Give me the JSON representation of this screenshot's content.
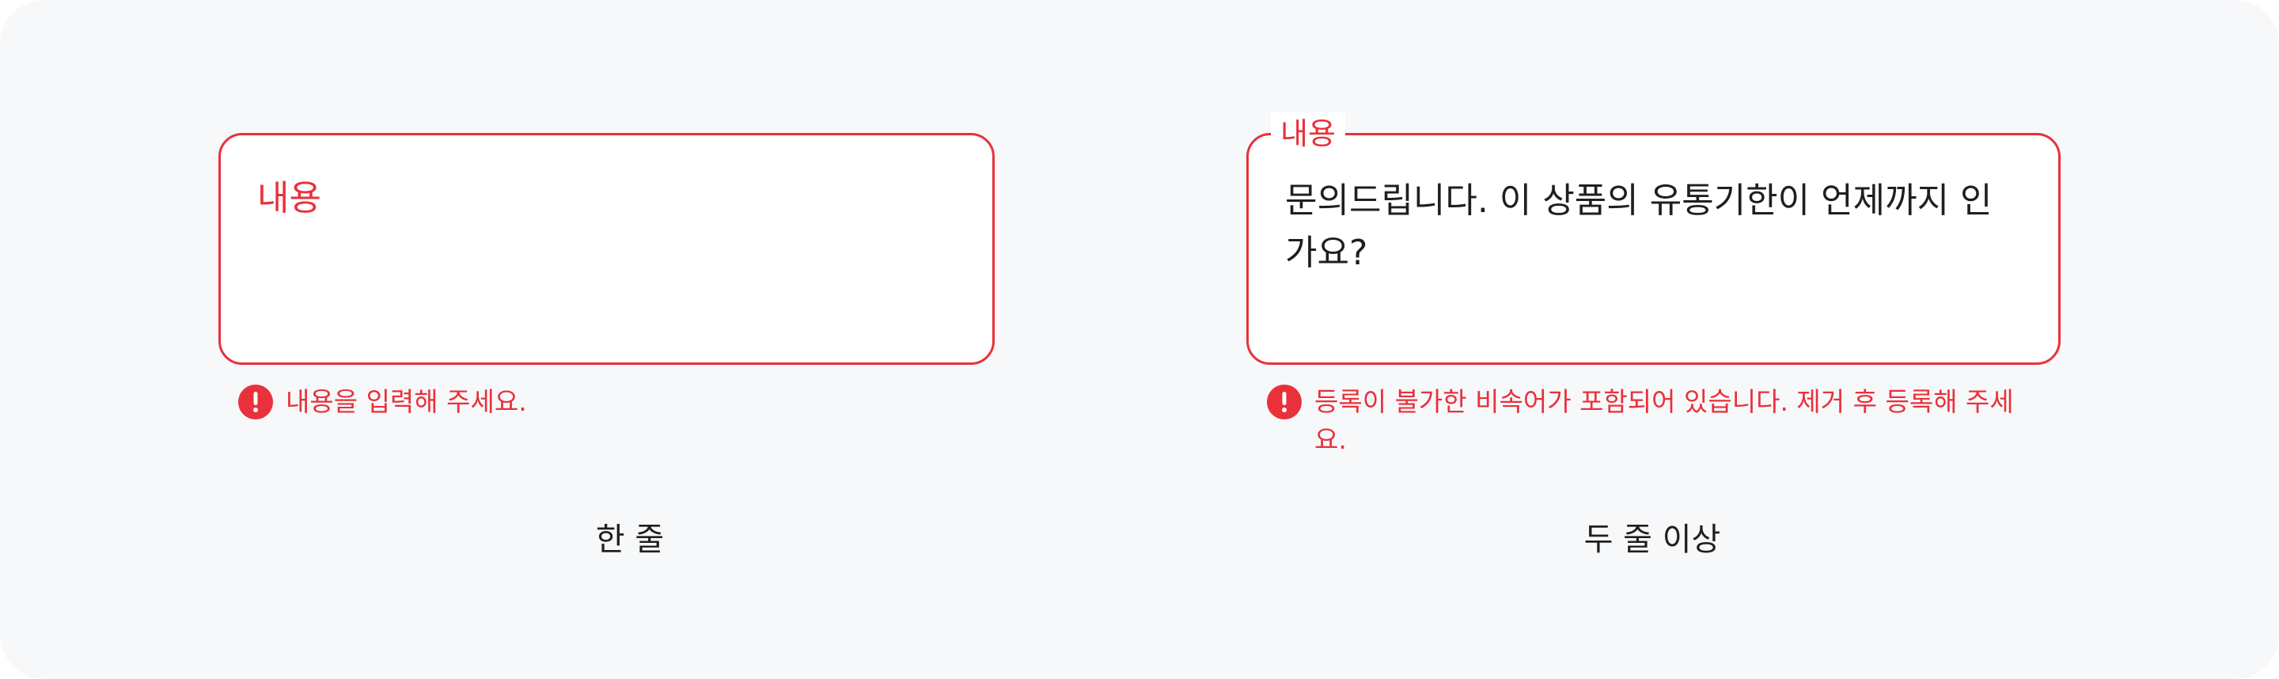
{
  "examples": [
    {
      "field_label": "내용",
      "field_value": "",
      "error_message": "내용을 입력해 주세요.",
      "caption": "한 줄"
    },
    {
      "field_label": "내용",
      "field_value": "문의드립니다. 이 상품의 유통기한이 언제까지 인가요?",
      "error_message": "등록이 불가한 비속어가 포함되어 있습니다. 제거 후 등록해 주세요.",
      "caption": "두 줄 이상"
    }
  ],
  "icons": {
    "error": "exclamation-circle-icon"
  },
  "colors": {
    "error": "#e8313a",
    "background": "#f7f8fa",
    "text": "#1f1f1f"
  }
}
